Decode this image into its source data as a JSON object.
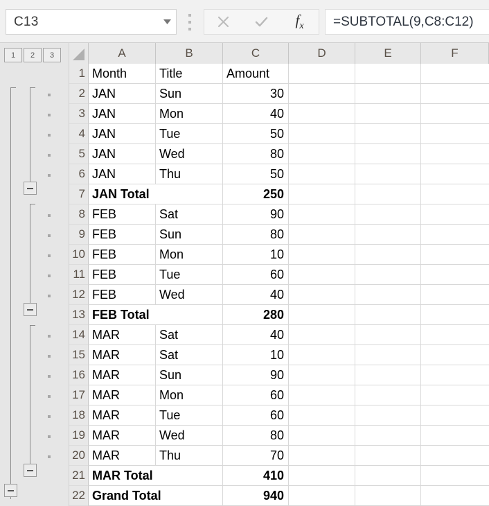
{
  "formula_bar": {
    "name_box_value": "C13",
    "name_box_dropdown_icon": "chevron-down-icon",
    "cancel_icon": "close-x-icon",
    "confirm_icon": "checkmark-icon",
    "function_icon": "fx-insert-function-icon",
    "formula_value": "=SUBTOTAL(9,C8:C12)"
  },
  "outline": {
    "level_buttons": [
      "1",
      "2",
      "3"
    ],
    "collapse_icon": "minus-icon",
    "collapse_rows": [
      7,
      13,
      21,
      22
    ],
    "detail_dot_rows": [
      2,
      3,
      4,
      5,
      6,
      8,
      9,
      10,
      11,
      12,
      14,
      15,
      16,
      17,
      18,
      19,
      20
    ]
  },
  "grid": {
    "select_all_icon": "select-all-triangle-icon",
    "columns": [
      "A",
      "B",
      "C",
      "D",
      "E",
      "F"
    ],
    "row_numbers": [
      "1",
      "2",
      "3",
      "4",
      "5",
      "6",
      "7",
      "8",
      "9",
      "10",
      "11",
      "12",
      "13",
      "14",
      "15",
      "16",
      "17",
      "18",
      "19",
      "20",
      "21",
      "22"
    ],
    "rows": [
      {
        "n": "1",
        "a": "Month",
        "b": "Title",
        "c": "Amount",
        "bold": false,
        "overflow": false
      },
      {
        "n": "2",
        "a": "JAN",
        "b": "Sun",
        "c": "30",
        "bold": false,
        "overflow": false
      },
      {
        "n": "3",
        "a": "JAN",
        "b": "Mon",
        "c": "40",
        "bold": false,
        "overflow": false
      },
      {
        "n": "4",
        "a": "JAN",
        "b": "Tue",
        "c": "50",
        "bold": false,
        "overflow": false
      },
      {
        "n": "5",
        "a": "JAN",
        "b": "Wed",
        "c": "80",
        "bold": false,
        "overflow": false
      },
      {
        "n": "6",
        "a": "JAN",
        "b": "Thu",
        "c": "50",
        "bold": false,
        "overflow": false
      },
      {
        "n": "7",
        "a": "JAN Total",
        "b": "",
        "c": "250",
        "bold": true,
        "overflow": true
      },
      {
        "n": "8",
        "a": "FEB",
        "b": "Sat",
        "c": "90",
        "bold": false,
        "overflow": false
      },
      {
        "n": "9",
        "a": "FEB",
        "b": "Sun",
        "c": "80",
        "bold": false,
        "overflow": false
      },
      {
        "n": "10",
        "a": "FEB",
        "b": "Mon",
        "c": "10",
        "bold": false,
        "overflow": false
      },
      {
        "n": "11",
        "a": "FEB",
        "b": "Tue",
        "c": "60",
        "bold": false,
        "overflow": false
      },
      {
        "n": "12",
        "a": "FEB",
        "b": "Wed",
        "c": "40",
        "bold": false,
        "overflow": false
      },
      {
        "n": "13",
        "a": "FEB Total",
        "b": "",
        "c": "280",
        "bold": true,
        "overflow": true
      },
      {
        "n": "14",
        "a": "MAR",
        "b": "Sat",
        "c": "40",
        "bold": false,
        "overflow": false
      },
      {
        "n": "15",
        "a": "MAR",
        "b": "Sat",
        "c": "10",
        "bold": false,
        "overflow": false
      },
      {
        "n": "16",
        "a": "MAR",
        "b": "Sun",
        "c": "90",
        "bold": false,
        "overflow": false
      },
      {
        "n": "17",
        "a": "MAR",
        "b": "Mon",
        "c": "60",
        "bold": false,
        "overflow": false
      },
      {
        "n": "18",
        "a": "MAR",
        "b": "Tue",
        "c": "60",
        "bold": false,
        "overflow": false
      },
      {
        "n": "19",
        "a": "MAR",
        "b": "Wed",
        "c": "80",
        "bold": false,
        "overflow": false
      },
      {
        "n": "20",
        "a": "MAR",
        "b": "Thu",
        "c": "70",
        "bold": false,
        "overflow": false
      },
      {
        "n": "21",
        "a": "MAR Total",
        "b": "",
        "c": "410",
        "bold": true,
        "overflow": true
      },
      {
        "n": "22",
        "a": "Grand Total",
        "b": "",
        "c": "940",
        "bold": true,
        "overflow": true
      }
    ]
  },
  "colors": {
    "header_bg": "#e8e8e8",
    "outline_bg": "#e6e6e6",
    "gridline": "#d8d8d8",
    "header_text": "#5a5148",
    "cell_text": "#000000"
  }
}
